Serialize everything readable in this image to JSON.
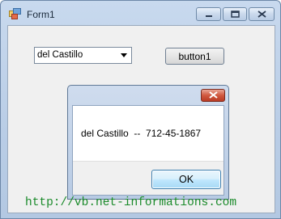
{
  "window": {
    "title": "Form1",
    "icons": [
      "app-icon",
      "minimize-icon",
      "maximize-icon",
      "close-icon"
    ]
  },
  "form": {
    "combo_value": "del Castillo",
    "button_label": "button1"
  },
  "messagebox": {
    "text": "del Castillo  --  712-45-1867",
    "ok_label": "OK"
  },
  "watermark": "http://vb.net-informations.com",
  "colors": {
    "title_bg": "#b9cde6",
    "ok_accent": "#3c7fb1",
    "close_red": "#c84a33",
    "url_green": "#1a8a2a"
  }
}
